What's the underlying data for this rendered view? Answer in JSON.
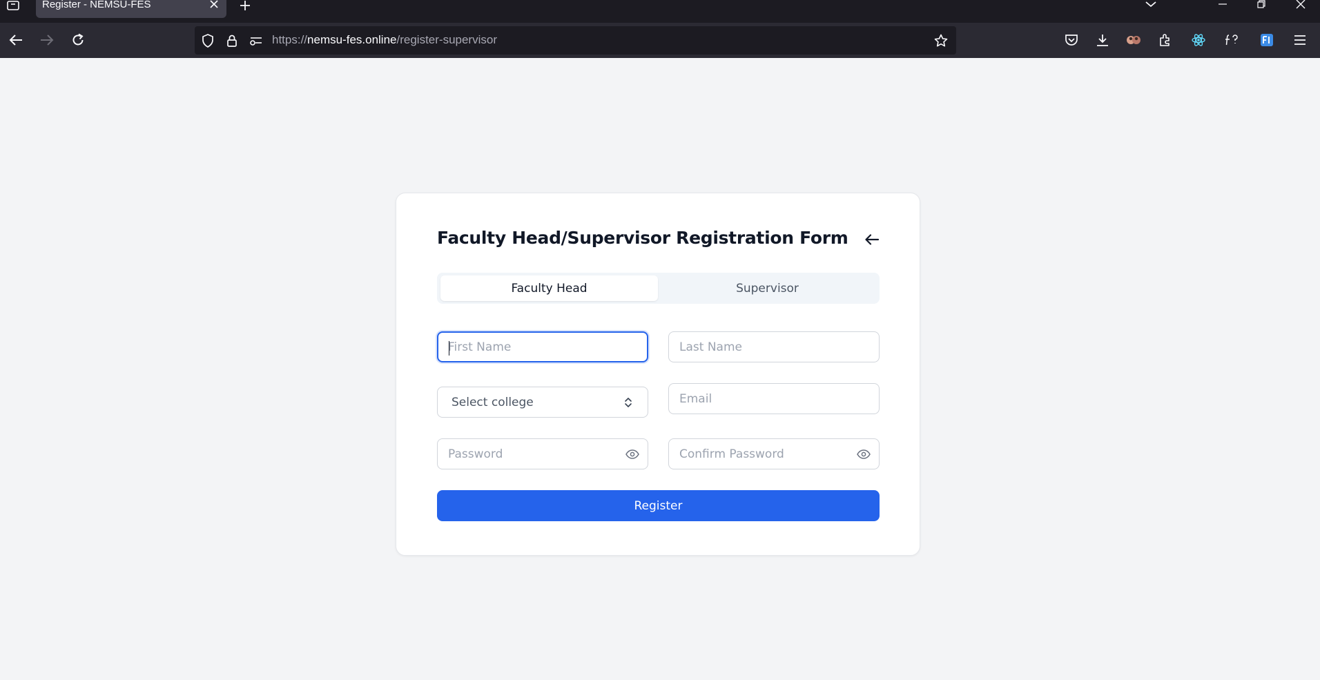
{
  "browser": {
    "tab_title": "Register - NEMSU-FES",
    "url_scheme": "https://",
    "url_host": "nemsu-fes.online",
    "url_path": "/register-supervisor"
  },
  "form": {
    "title": "Faculty Head/Supervisor Registration Form",
    "tabs": [
      {
        "label": "Faculty Head",
        "active": true
      },
      {
        "label": "Supervisor",
        "active": false
      }
    ],
    "first_name_placeholder": "First Name",
    "last_name_placeholder": "Last Name",
    "college_select": "Select college",
    "email_placeholder": "Email",
    "password_placeholder": "Password",
    "confirm_password_placeholder": "Confirm Password",
    "submit_label": "Register"
  },
  "colors": {
    "primary": "#2563eb",
    "page_bg": "#f3f4f6",
    "browser_dark": "#1c1b22"
  }
}
